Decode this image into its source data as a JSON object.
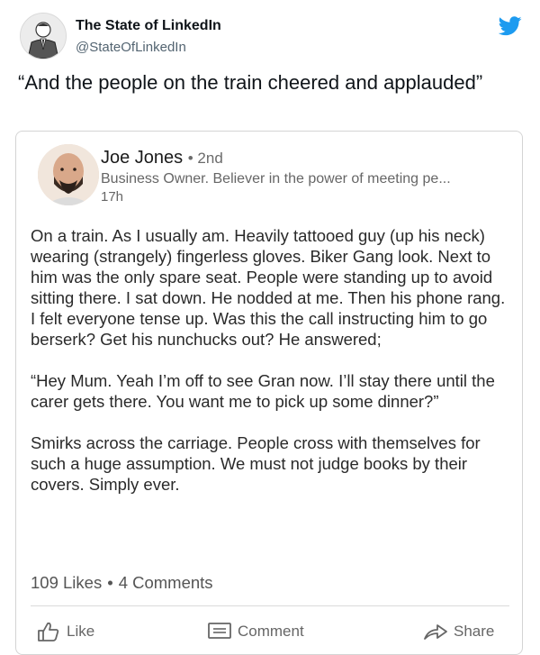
{
  "tweet": {
    "author_name": "The State of LinkedIn",
    "author_handle": "@StateOfLinkedIn",
    "text": "“And the people on the train cheered and applauded”"
  },
  "icons": {
    "twitter": "twitter-bird-icon",
    "like": "thumbs-up-icon",
    "comment": "comment-icon",
    "share": "share-arrow-icon"
  },
  "colors": {
    "twitter_blue": "#1d9bf0",
    "text_dark": "#0f1419",
    "text_secondary": "#536471",
    "card_border": "#d4d4d4"
  },
  "linkedin_post": {
    "name": "Joe Jones",
    "degree": "• 2nd",
    "headline": "Business Owner. Believer in the power of meeting pe...",
    "time": "17h",
    "paragraphs": [
      "On a train. As I usually am. Heavily tattooed guy (up his neck) wearing (strangely) fingerless gloves. Biker Gang look. Next to him was the only spare seat. People were standing up to avoid sitting there. I sat down. He nodded at me. Then his phone rang. I felt everyone tense up. Was this the call instructing him to go berserk? Get his nunchucks out? He answered;",
      "“Hey Mum. Yeah I’m off to see Gran now. I’ll stay there until the carer gets there. You want me to pick up some dinner?”",
      "Smirks across the carriage. People cross with themselves for such a huge assumption. We must not judge books by their covers. Simply ever."
    ],
    "likes": "109 Likes",
    "separator": "•",
    "comments": "4 Comments",
    "actions": {
      "like": "Like",
      "comment": "Comment",
      "share": "Share"
    }
  }
}
